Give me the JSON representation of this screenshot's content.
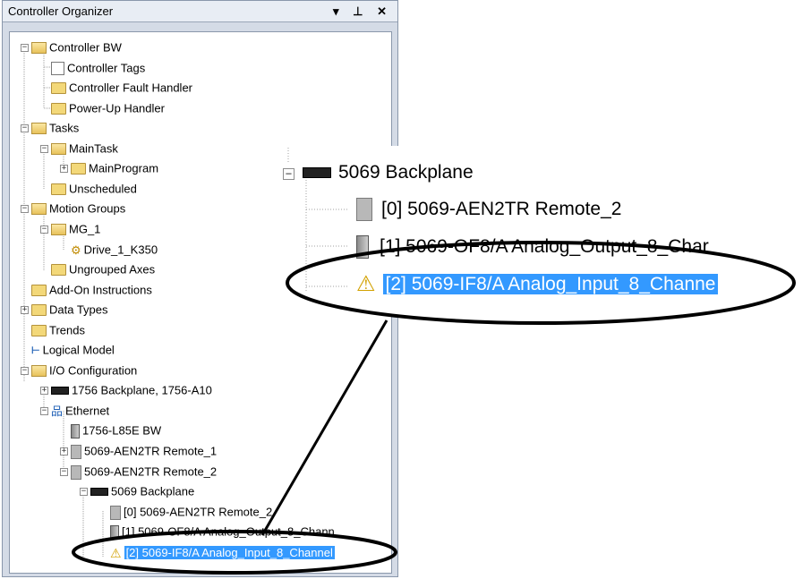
{
  "panel": {
    "title": "Controller Organizer",
    "title_controls": "▾ ⊥ ✕"
  },
  "tree": {
    "controller_bw": "Controller BW",
    "controller_tags": "Controller Tags",
    "controller_fault_handler": "Controller Fault Handler",
    "power_up_handler": "Power-Up Handler",
    "tasks": "Tasks",
    "main_task": "MainTask",
    "main_program": "MainProgram",
    "unscheduled": "Unscheduled",
    "motion_groups": "Motion Groups",
    "mg_1": "MG_1",
    "drive_1": "Drive_1_K350",
    "ungrouped_axes": "Ungrouped Axes",
    "add_on_instructions": "Add-On Instructions",
    "data_types": "Data Types",
    "trends": "Trends",
    "logical_model": "Logical Model",
    "io_configuration": "I/O Configuration",
    "backplane_1756": "1756 Backplane, 1756-A10",
    "ethernet": "Ethernet",
    "l85e": "1756-L85E BW",
    "remote_1": "5069-AEN2TR Remote_1",
    "remote_2": "5069-AEN2TR Remote_2",
    "backplane_5069": "5069 Backplane",
    "slot_0": "[0] 5069-AEN2TR Remote_2",
    "slot_1": "[1] 5069-OF8/A Analog_Output_8_Chann",
    "slot_2": "[2] 5069-IF8/A Analog_Input_8_Channel"
  },
  "zoom": {
    "backplane": "5069 Backplane",
    "slot_0": "[0] 5069-AEN2TR Remote_2",
    "slot_1": "[1] 5069-OF8/A Analog_Output_8_Char",
    "slot_2": "[2] 5069-IF8/A Analog_Input_8_Channe"
  },
  "colors": {
    "selection": "#3399ff",
    "panel_bg": "#d4dbe6",
    "folder": "#f3d879"
  }
}
